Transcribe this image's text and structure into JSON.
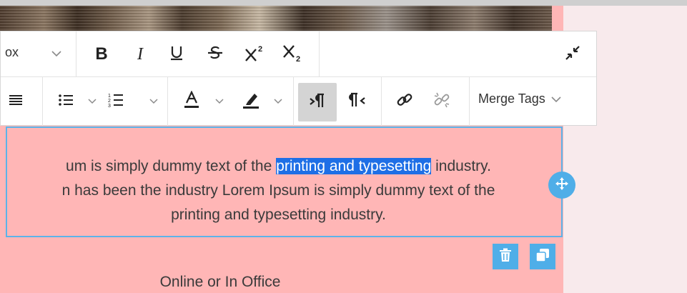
{
  "toolbar": {
    "font_family_partial": "ox",
    "bold": "B",
    "italic": "I",
    "merge_tags_label": "Merge Tags"
  },
  "editor": {
    "line1_before": "um is simply dummy text of the ",
    "line1_selected": "printing and typesetting",
    "line1_after": " industry.",
    "line2": "n has been the industry Lorem Ipsum is simply dummy text of the",
    "line3": "printing and typesetting industry."
  },
  "below": {
    "text": "Online or In Office"
  },
  "colors": {
    "block_background": "#ffb6b6",
    "selection": "#1e6fe6",
    "accent": "#4faee8"
  }
}
